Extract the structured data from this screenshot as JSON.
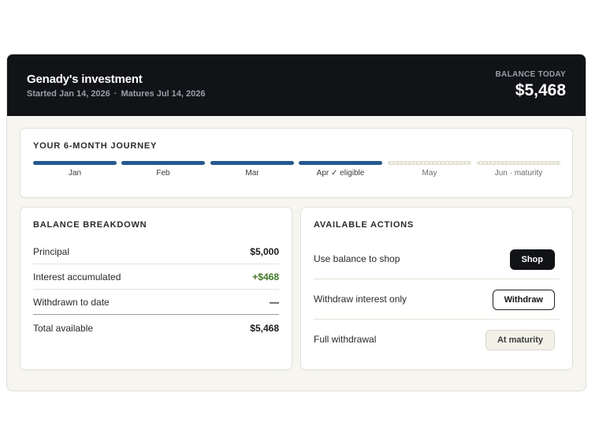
{
  "header": {
    "title": "Genady's investment",
    "started": "Started Jan 14, 2026",
    "separator": "·",
    "matures": "Matures Jul 14, 2026",
    "balance_label": "BALANCE TODAY",
    "balance": "$5,468"
  },
  "journey": {
    "title": "YOUR 6-MONTH JOURNEY",
    "months": [
      {
        "label": "Jan",
        "complete": true
      },
      {
        "label": "Feb",
        "complete": true
      },
      {
        "label": "Mar",
        "complete": true
      },
      {
        "label": "Apr ✓ eligible",
        "complete": true
      },
      {
        "label": "May",
        "complete": false
      },
      {
        "label": "Jun · maturity",
        "complete": false
      }
    ]
  },
  "breakdown": {
    "title": "BALANCE BREAKDOWN",
    "rows": [
      {
        "label": "Principal",
        "value": "$5,000"
      },
      {
        "label": "Interest accumulated",
        "value": "+$468"
      },
      {
        "label": "Withdrawn to date",
        "value": "—"
      },
      {
        "label": "Total available",
        "value": "$5,468"
      }
    ]
  },
  "actions": {
    "title": "AVAILABLE ACTIONS",
    "rows": [
      {
        "label": "Use balance to shop",
        "button": "Shop"
      },
      {
        "label": "Withdraw interest only",
        "button": "Withdraw"
      },
      {
        "label": "Full withdrawal",
        "button": "At maturity"
      }
    ]
  },
  "colors": {
    "header_bg": "#111316",
    "progress_complete": "#245a8f",
    "positive": "#3d7a22"
  }
}
